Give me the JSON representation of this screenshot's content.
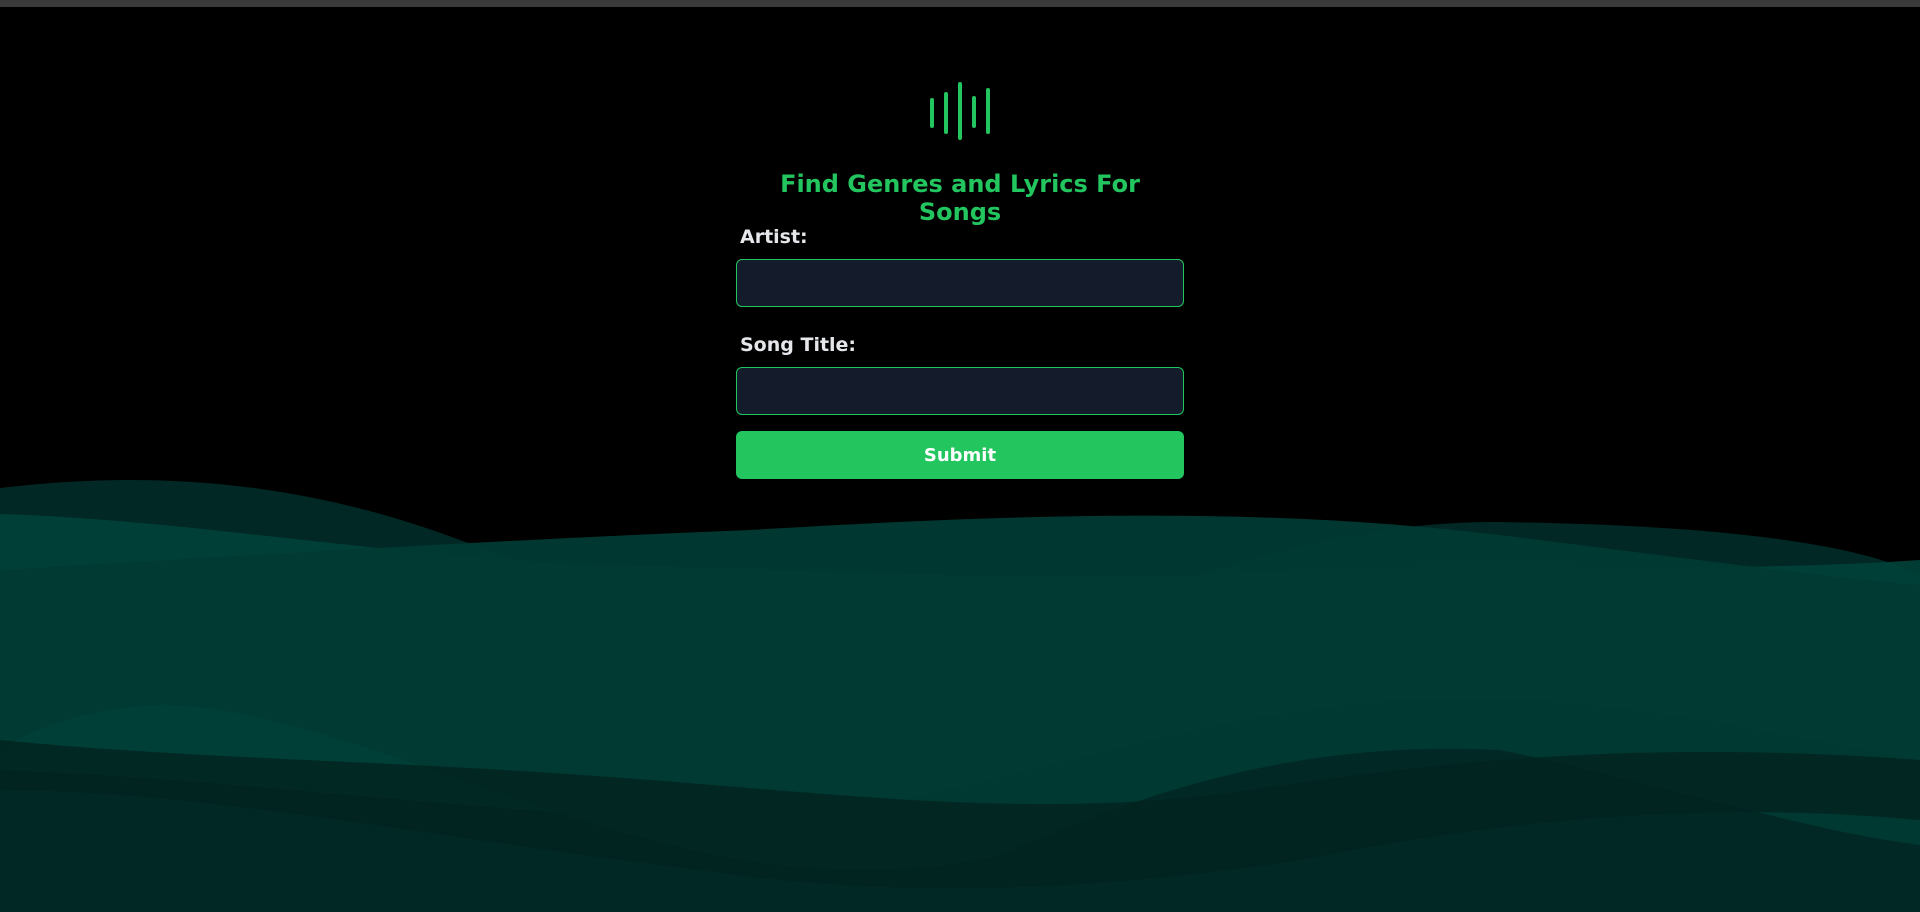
{
  "app": {
    "logo_icon": "sound-wave-icon",
    "heading": "Find Genres and Lyrics For Songs",
    "accent_color": "#22c55e",
    "background_color": "#000000",
    "wave_color": "#003a34"
  },
  "form": {
    "artist_label": "Artist:",
    "artist_value": "",
    "song_label": "Song Title:",
    "song_value": "",
    "submit_label": "Submit"
  }
}
